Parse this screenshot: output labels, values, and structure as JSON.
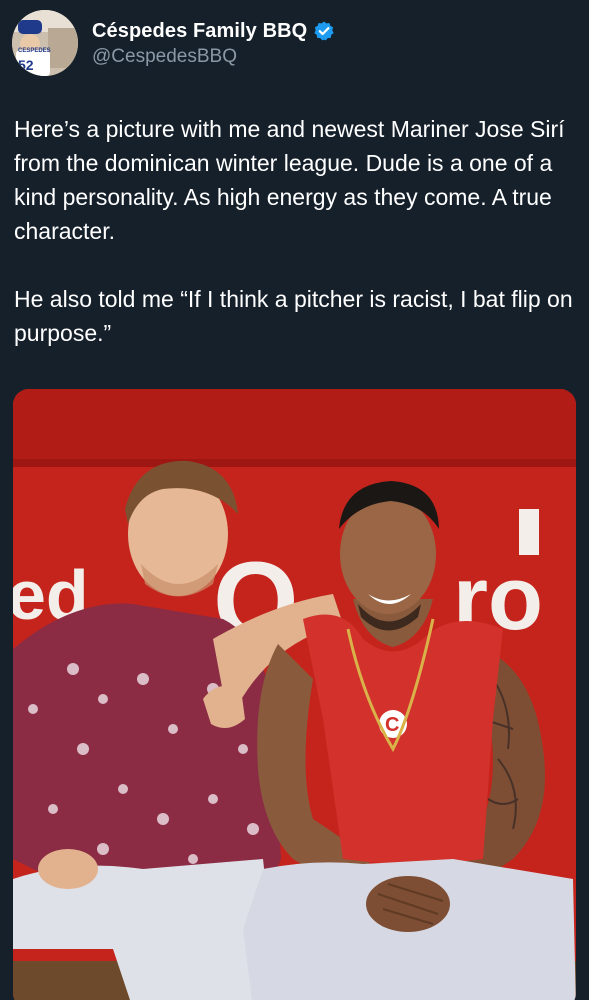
{
  "author": {
    "display_name": "Céspedes Family BBQ",
    "handle": "@CespedesBBQ",
    "verified": true,
    "avatar_icon": "profile-avatar"
  },
  "tweet": {
    "paragraphs": [
      "Here’s a picture with me and newest Mariner Jose Sirí from the dominican winter league. Dude is a one of a kind personality. As high energy as they come. A true character.",
      "He also told me “If I think a pitcher is racist, I bat flip on purpose.”"
    ]
  },
  "media": {
    "wall_text_left": "ed",
    "wall_text_mid": "O",
    "wall_text_right": "ro",
    "jersey_logo": "C"
  },
  "colors": {
    "background": "#15202b",
    "secondary_text": "#8b98a5",
    "verified_badge": "#1d9bf0",
    "wall_red": "#c5241d"
  }
}
